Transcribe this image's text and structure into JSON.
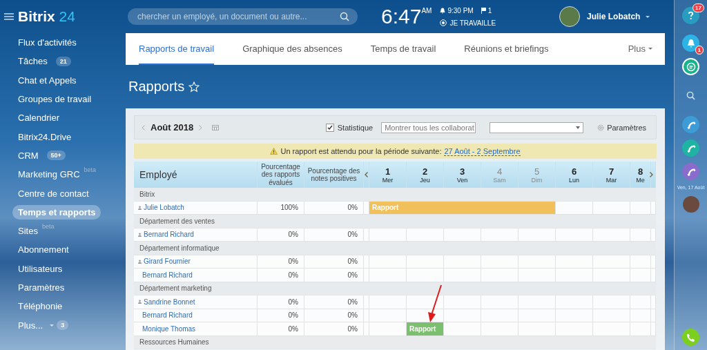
{
  "sidebar": {
    "logo": {
      "name": "Bitrix",
      "number": "24"
    },
    "items": [
      {
        "label": "Flux d'activités",
        "selected": false,
        "dropdown": false
      },
      {
        "label": "Tâches",
        "badge": "21",
        "selected": false,
        "dropdown": false
      },
      {
        "label": "Chat et Appels",
        "selected": false,
        "dropdown": false
      },
      {
        "label": "Groupes de travail",
        "selected": false,
        "dropdown": false
      },
      {
        "label": "Calendrier",
        "selected": false,
        "dropdown": false
      },
      {
        "label": "Bitrix24.Drive",
        "selected": false,
        "dropdown": false
      },
      {
        "label": "CRM",
        "badge": "50+",
        "selected": false,
        "dropdown": false
      },
      {
        "label": "Marketing GRC",
        "tag": "beta",
        "selected": false,
        "dropdown": false
      },
      {
        "label": "Centre de contact",
        "selected": false,
        "dropdown": false
      },
      {
        "label": "Temps et rapports",
        "selected": true,
        "dropdown": false
      },
      {
        "label": "Sites",
        "tag": "beta",
        "selected": false,
        "dropdown": false
      },
      {
        "label": "Abonnement",
        "selected": false,
        "dropdown": false
      },
      {
        "label": "Utilisateurs",
        "selected": false,
        "dropdown": false
      },
      {
        "label": "Paramètres",
        "selected": false,
        "dropdown": false
      },
      {
        "label": "Téléphonie",
        "selected": false,
        "dropdown": false
      },
      {
        "label": "Plus...",
        "badge": "3",
        "dropdown": true,
        "selected": false
      }
    ]
  },
  "header": {
    "search": {
      "placeholder": "chercher un employé, un document ou autre..."
    },
    "clock": {
      "time": "6:47",
      "period": "AM"
    },
    "reminder": "9:30 PM",
    "flags": "1",
    "status": "JE TRAVAILLE",
    "user": {
      "name": "Julie Lobatch"
    }
  },
  "tabs": [
    {
      "label": "Rapports de travail",
      "selected": true
    },
    {
      "label": "Graphique des absences",
      "selected": false
    },
    {
      "label": "Temps de travail",
      "selected": false
    },
    {
      "label": "Réunions et briefings",
      "selected": false
    }
  ],
  "more_tab": "Plus",
  "page": {
    "title": "Rapports",
    "starred": false
  },
  "toolbar": {
    "month": "Août 2018",
    "statistics": {
      "label": "Statistique",
      "checked": true
    },
    "filter": "Montrer tous les collaborat",
    "settings": "Paramètres"
  },
  "notice": {
    "text": "Un rapport est attendu pour la période suivante:",
    "link": "27 Août - 2 Septembre"
  },
  "table": {
    "columns": [
      "Employé",
      "Pourcentage des rapports évalués",
      "Pourcentage des notes positives"
    ],
    "days": [
      {
        "day": "1",
        "weekday": "Mer",
        "weekend": false
      },
      {
        "day": "2",
        "weekday": "Jeu",
        "weekend": false
      },
      {
        "day": "3",
        "weekday": "Ven",
        "weekend": false
      },
      {
        "day": "4",
        "weekday": "Sam",
        "weekend": true
      },
      {
        "day": "5",
        "weekday": "Dim",
        "weekend": true
      },
      {
        "day": "6",
        "weekday": "Lun",
        "weekend": false
      },
      {
        "day": "7",
        "weekday": "Mar",
        "weekend": false
      },
      {
        "day": "8",
        "weekday": "Me",
        "weekend": false
      }
    ],
    "rows": [
      {
        "kind": "group",
        "label": "Bitrix"
      },
      {
        "kind": "person",
        "name": "Julie Lobatch",
        "head": true,
        "evaluated": "100%",
        "positive": "0%",
        "report": {
          "label": "Rapport",
          "color": "#f2c05a"
        },
        "day_cells": [
          {
            "report": true
          },
          {
            "report": true
          },
          {
            "report": true
          },
          {
            "report": true
          },
          {
            "report": true
          },
          {
            "report": false
          },
          {
            "report": false
          },
          {
            "report": false
          }
        ]
      },
      {
        "kind": "group",
        "label": "Département des ventes"
      },
      {
        "kind": "person",
        "name": "Bernard Richard",
        "head": true,
        "evaluated": "0%",
        "positive": "0%",
        "day_cells": [
          {
            "report": false
          },
          {
            "report": false
          },
          {
            "report": false
          },
          {
            "report": false
          },
          {
            "report": false
          },
          {
            "report": false
          },
          {
            "report": false
          },
          {
            "report": false
          }
        ]
      },
      {
        "kind": "group",
        "label": "Département informatique"
      },
      {
        "kind": "person",
        "name": "Girard Fournier",
        "head": true,
        "evaluated": "0%",
        "positive": "0%",
        "day_cells": [
          {
            "report": false
          },
          {
            "report": false
          },
          {
            "report": false
          },
          {
            "report": false
          },
          {
            "report": false
          },
          {
            "report": false
          },
          {
            "report": false
          },
          {
            "report": false
          }
        ]
      },
      {
        "kind": "person",
        "name": "Bernard Richard",
        "head": false,
        "evaluated": "0%",
        "positive": "0%",
        "day_cells": [
          {
            "report": false
          },
          {
            "report": false
          },
          {
            "report": false
          },
          {
            "report": false
          },
          {
            "report": false
          },
          {
            "report": false
          },
          {
            "report": false
          },
          {
            "report": false
          }
        ]
      },
      {
        "kind": "group",
        "label": "Département marketing"
      },
      {
        "kind": "person",
        "name": "Sandrine Bonnet",
        "head": true,
        "evaluated": "0%",
        "positive": "0%",
        "day_cells": [
          {
            "report": false
          },
          {
            "report": false
          },
          {
            "report": false
          },
          {
            "report": false
          },
          {
            "report": false
          },
          {
            "report": false
          },
          {
            "report": false
          },
          {
            "report": false
          }
        ]
      },
      {
        "kind": "person",
        "name": "Bernard Richard",
        "head": false,
        "evaluated": "0%",
        "positive": "0%",
        "day_cells": [
          {
            "report": false
          },
          {
            "report": false
          },
          {
            "report": false
          },
          {
            "report": false
          },
          {
            "report": false
          },
          {
            "report": false
          },
          {
            "report": false
          },
          {
            "report": false
          }
        ]
      },
      {
        "kind": "person",
        "name": "Monique Thomas",
        "head": false,
        "evaluated": "0%",
        "positive": "0%",
        "report": {
          "label": "Rapport",
          "color": "#7cbf6e"
        },
        "day_cells": [
          {
            "report": false
          },
          {
            "report": true
          },
          {
            "report": false
          },
          {
            "report": false
          },
          {
            "report": false
          },
          {
            "report": false
          },
          {
            "report": false
          },
          {
            "report": false
          }
        ]
      },
      {
        "kind": "group",
        "label": "Ressources Humaines"
      }
    ]
  },
  "rightbar": {
    "help_badge": "17",
    "notifications_badge": "1",
    "lines": [
      {
        "color": "#3d9bd6"
      },
      {
        "color": "#1eb3a3"
      },
      {
        "color": "#8a6ccc"
      }
    ],
    "date": "Ven, 17 Août"
  }
}
